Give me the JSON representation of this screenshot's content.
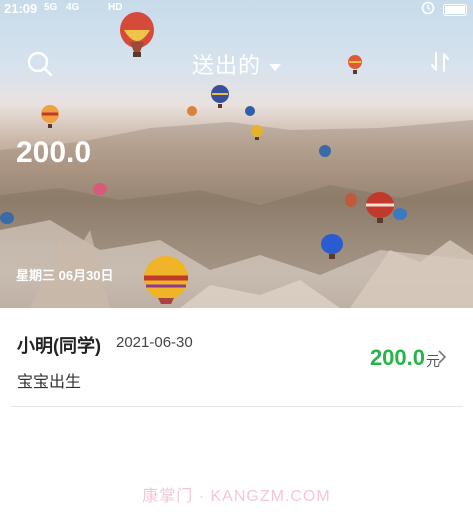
{
  "status_bar": {
    "time": "21:09",
    "signal_1": "5G",
    "signal_2": "4G",
    "network": "HD"
  },
  "header": {
    "title": "送出的"
  },
  "summary": {
    "total": "200.0",
    "date": "星期三 06月30日"
  },
  "records": [
    {
      "name": "小明(同学)",
      "date": "2021-06-30",
      "note": "宝宝出生",
      "amount": "200.0",
      "unit": "元"
    }
  ],
  "watermark": "康掌门 · KANGZM.COM",
  "colors": {
    "amount": "#27b54a",
    "header_text": "#ffffff"
  }
}
